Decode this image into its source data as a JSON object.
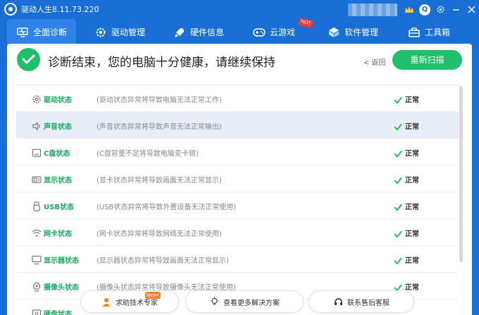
{
  "window": {
    "title": "驱动人生8.11.73.220"
  },
  "titlebar": {
    "icons": [
      "crown-icon",
      "qq-icon",
      "gear-icon",
      "minimize-icon",
      "close-icon"
    ],
    "avatar_label": "Q"
  },
  "nav": {
    "tabs": [
      {
        "label": "全面诊断",
        "icon": "monitor-pulse-icon",
        "active": true
      },
      {
        "label": "驱动管理",
        "icon": "gear-icon",
        "active": false
      },
      {
        "label": "硬件信息",
        "icon": "rocket-icon",
        "active": false
      },
      {
        "label": "云游戏",
        "icon": "gamepad-icon",
        "active": false
      },
      {
        "label": "软件管理",
        "icon": "cube-icon",
        "active": false
      },
      {
        "label": "工具箱",
        "icon": "toolbox-icon",
        "active": false
      }
    ],
    "hot_badge": "HOT"
  },
  "header": {
    "title": "诊断结束，您的电脑十分健康，请继续保持",
    "back_label": "< 返回",
    "rescan_label": "重新扫描"
  },
  "colors": {
    "brand_blue": "#1a6fd6",
    "success_green": "#1fbf6c",
    "name_green": "#1aa861"
  },
  "diagnostics": [
    {
      "name": "驱动状态",
      "desc": "(驱动状态异常将导致电脑无法正常工作)",
      "status": "正常",
      "icon": "gear-icon"
    },
    {
      "name": "声音状态",
      "desc": "(声音状态异常将导致声音无法正常输出)",
      "status": "正常",
      "icon": "speaker-icon"
    },
    {
      "name": "C盘状态",
      "desc": "(C盘容量不足将导致电脑变卡顿)",
      "status": "正常",
      "icon": "disk-icon"
    },
    {
      "name": "显示状态",
      "desc": "(显卡状态异常将导致画面无法正常显示)",
      "status": "正常",
      "icon": "gpu-icon"
    },
    {
      "name": "USB状态",
      "desc": "(USB状态异常将导致外置设备无法正常使用)",
      "status": "正常",
      "icon": "usb-icon"
    },
    {
      "name": "网卡状态",
      "desc": "(网卡状态异常将导致网络无法正常使用)",
      "status": "正常",
      "icon": "wifi-icon"
    },
    {
      "name": "显示器状态",
      "desc": "(显示器状态异常将导致画面无法正常显示)",
      "status": "正常",
      "icon": "monitor-icon"
    },
    {
      "name": "摄像头状态",
      "desc": "(摄像头状态异常将导致摄像头无法正常使用)",
      "status": "正常",
      "icon": "camera-icon"
    },
    {
      "name": "硬盘状态",
      "desc": "",
      "status": "",
      "icon": "harddisk-icon"
    }
  ],
  "footer": {
    "buttons": [
      {
        "label": "求助技术专家",
        "icon": "person-icon"
      },
      {
        "label": "查看更多解决方案",
        "icon": "lightbulb-icon"
      },
      {
        "label": "联系售后客服",
        "icon": "headset-icon"
      }
    ],
    "new_badge": "New!"
  }
}
